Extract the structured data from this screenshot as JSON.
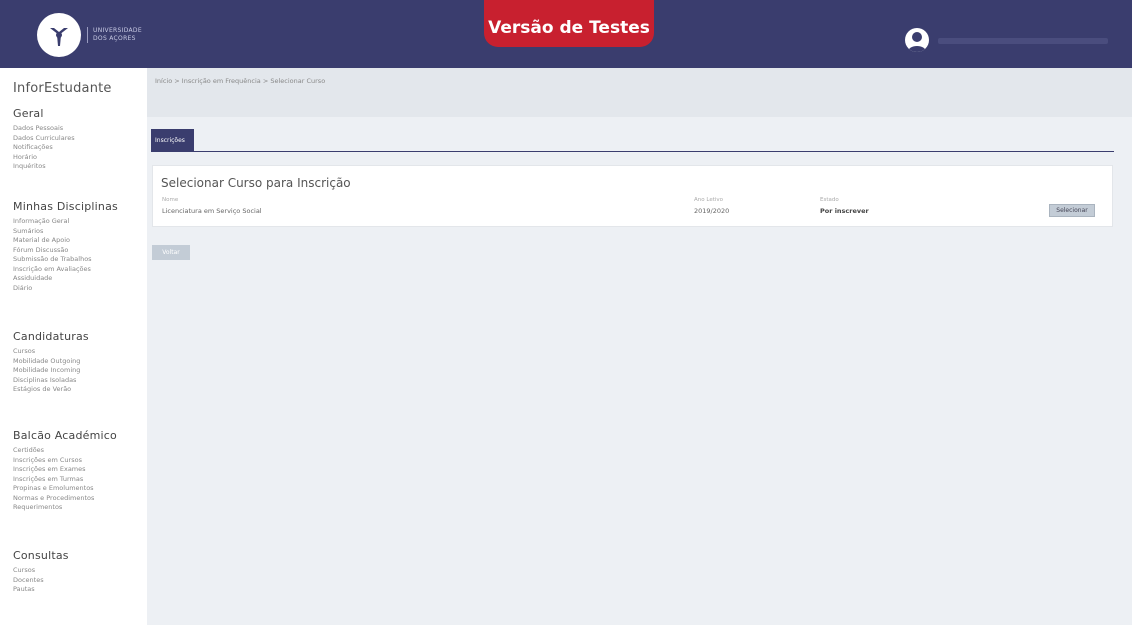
{
  "header": {
    "logo_text_line1": "UNIVERSIDADE",
    "logo_text_line2": "DOS AÇORES",
    "test_banner": "Versão de Testes"
  },
  "sidebar": {
    "app_title": "InforEstudante",
    "sections": [
      {
        "title": "Geral",
        "items": [
          "Dados Pessoais",
          "Dados Curriculares",
          "Notificações",
          "Horário",
          "Inquéritos"
        ]
      },
      {
        "title": "Minhas Disciplinas",
        "items": [
          "Informação Geral",
          "Sumários",
          "Material de Apoio",
          "Fórum Discussão",
          "Submissão de Trabalhos",
          "Inscrição em Avaliações",
          "Assiduidade",
          "Diário"
        ]
      },
      {
        "title": "Candidaturas",
        "items": [
          "Cursos",
          "Mobilidade Outgoing",
          "Mobilidade Incoming",
          "Disciplinas Isoladas",
          "Estágios de Verão"
        ]
      },
      {
        "title": "Balcão Académico",
        "items": [
          "Certidões",
          "Inscrições em Cursos",
          "Inscrições em Exames",
          "Inscrições em Turmas",
          "Propinas e Emolumentos",
          "Normas e Procedimentos",
          "Requerimentos"
        ]
      },
      {
        "title": "Consultas",
        "items": [
          "Cursos",
          "Docentes",
          "Pautas"
        ]
      }
    ]
  },
  "main": {
    "breadcrumb": "Início > Inscrição em Frequência > Selecionar Curso",
    "tab_label": "Inscrições",
    "card_title": "Selecionar Curso para Inscrição",
    "columns": [
      "Nome",
      "Ano Letivo",
      "Estado"
    ],
    "row": {
      "name": "Licenciatura em Serviço Social",
      "year": "2019/2020",
      "state": "Por inscrever",
      "action": "Selecionar"
    },
    "back_button": "Voltar"
  },
  "colors": {
    "header_bg": "#3a3d6e",
    "test_banner_bg": "#c8202f",
    "content_bg": "#edf0f4"
  }
}
